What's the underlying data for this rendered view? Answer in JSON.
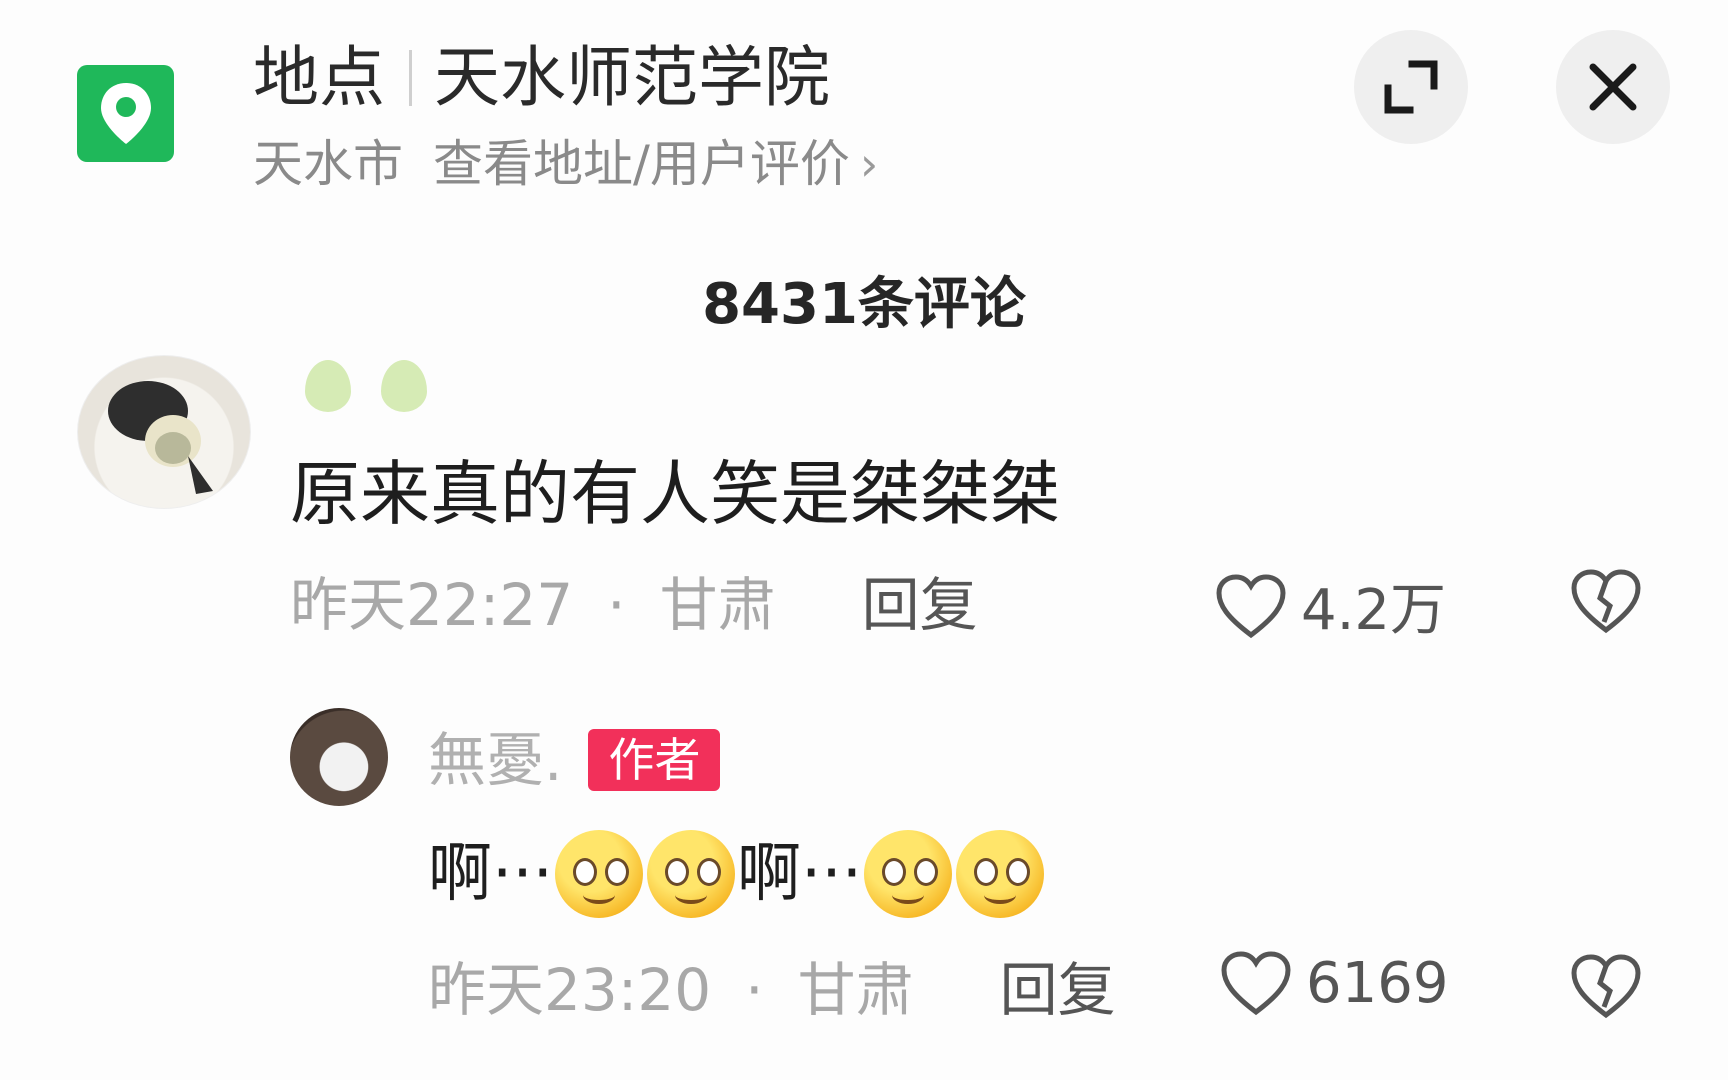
{
  "header": {
    "location_label": "地点",
    "place_name": "天水师范学院",
    "city": "天水市",
    "address_link": "查看地址/用户评价",
    "chevron": "›",
    "icons": [
      "location-pin-icon",
      "expand-icon",
      "close-icon"
    ],
    "accent_color": "#1fb85a"
  },
  "comments_count": "8431条评论",
  "comment": {
    "text": "原来真的有人笑是桀桀桀",
    "time": "昨天22:27",
    "separator": "·",
    "region": "甘肃",
    "reply_label": "回复",
    "likes": "4.2万"
  },
  "reply": {
    "username": "無憂.",
    "badge": "作者",
    "badge_color": "#f2305a",
    "text_part1": "啊···",
    "text_part2": "啊···",
    "emojis": [
      "dazed-emoji-icon",
      "wink-emoji-icon",
      "shocked-emoji-icon",
      "dazed-emoji-icon"
    ],
    "time": "昨天23:20",
    "separator": "·",
    "region": "甘肃",
    "reply_label": "回复",
    "likes": "6169"
  }
}
